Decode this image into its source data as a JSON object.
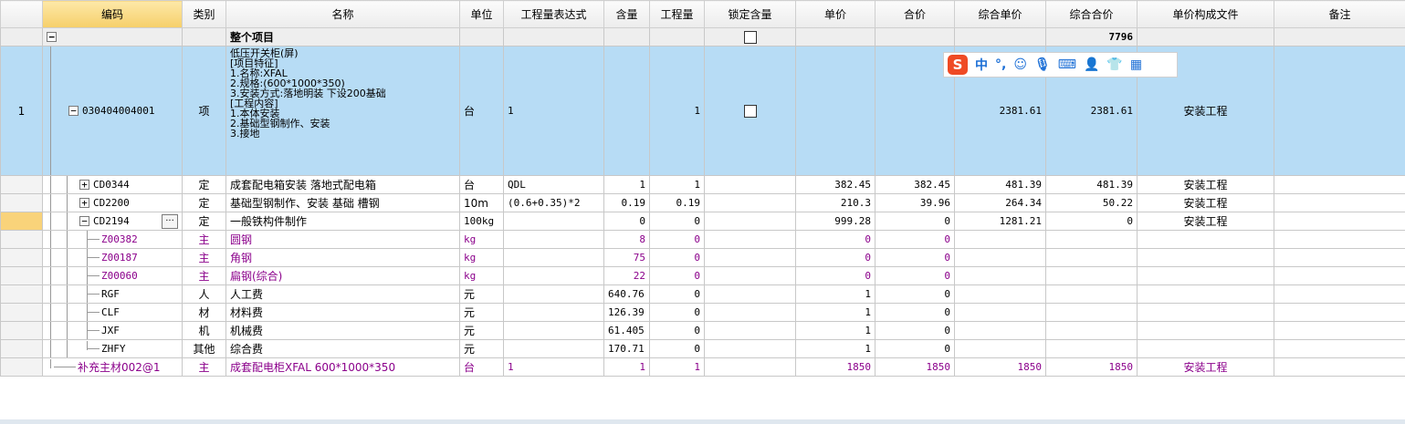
{
  "headers": [
    "",
    "编码",
    "类别",
    "名称",
    "单位",
    "工程量表达式",
    "含量",
    "工程量",
    "锁定含量",
    "单价",
    "合价",
    "综合单价",
    "综合合价",
    "单价构成文件",
    "备注"
  ],
  "total_row": {
    "name": "整个项目",
    "total": "7796"
  },
  "main_item": {
    "rownum": "1",
    "code": "030404004001",
    "type": "项",
    "desc": "低压开关柜(屏)\n[项目特征]\n1.名称:XFAL\n2.规格:(600*1000*350)\n3.安装方式:落地明装 下设200基础\n[工程内容]\n1.本体安装\n2.基础型钢制作、安装\n3.接地",
    "unit": "台",
    "expr": "1",
    "qty": "1",
    "unit_comp": "2381.61",
    "total_comp": "2381.61",
    "file": "安装工程"
  },
  "rows": [
    {
      "code": "CD0344",
      "type": "定",
      "name": "成套配电箱安装 落地式配电箱",
      "unit": "台",
      "expr": "QDL",
      "content": "1",
      "qty": "1",
      "price": "382.45",
      "total": "382.45",
      "unit_comp": "481.39",
      "total_comp": "481.39",
      "file": "安装工程",
      "expander": "+"
    },
    {
      "code": "CD2200",
      "type": "定",
      "name": "基础型钢制作、安装 基础 槽钢",
      "unit": "10m",
      "expr": "(0.6+0.35)*2",
      "content": "0.19",
      "qty": "0.19",
      "price": "210.3",
      "total": "39.96",
      "unit_comp": "264.34",
      "total_comp": "50.22",
      "file": "安装工程",
      "expander": "+"
    },
    {
      "code": "CD2194",
      "type": "定",
      "name": "一般铁构件制作",
      "unit": "100kg",
      "expr": "",
      "content": "0",
      "qty": "0",
      "price": "999.28",
      "total": "0",
      "unit_comp": "1281.21",
      "total_comp": "0",
      "file": "安装工程",
      "expander": "−",
      "ellipsis": "···"
    }
  ],
  "sub_rows": [
    {
      "code": "Z00382",
      "type": "主",
      "name": "圆钢",
      "unit": "kg",
      "content": "8",
      "qty": "0",
      "price": "0",
      "total": "0",
      "purple": true
    },
    {
      "code": "Z00187",
      "type": "主",
      "name": "角钢",
      "unit": "kg",
      "content": "75",
      "qty": "0",
      "price": "0",
      "total": "0",
      "purple": true
    },
    {
      "code": "Z00060",
      "type": "主",
      "name": "扁钢(综合)",
      "unit": "kg",
      "content": "22",
      "qty": "0",
      "price": "0",
      "total": "0",
      "purple": true
    },
    {
      "code": "RGF",
      "type": "人",
      "name": "人工费",
      "unit": "元",
      "content": "640.76",
      "qty": "0",
      "price": "1",
      "total": "0",
      "purple": false
    },
    {
      "code": "CLF",
      "type": "材",
      "name": "材料费",
      "unit": "元",
      "content": "126.39",
      "qty": "0",
      "price": "1",
      "total": "0",
      "purple": false
    },
    {
      "code": "JXF",
      "type": "机",
      "name": "机械费",
      "unit": "元",
      "content": "61.405",
      "qty": "0",
      "price": "1",
      "total": "0",
      "purple": false
    },
    {
      "code": "ZHFY",
      "type": "其他",
      "name": "综合费",
      "unit": "元",
      "content": "170.71",
      "qty": "0",
      "price": "1",
      "total": "0",
      "purple": false
    }
  ],
  "last_row": {
    "code": "补充主材002@1",
    "type": "主",
    "name": "成套配电柜XFAL 600*1000*350",
    "unit": "台",
    "expr": "1",
    "content": "1",
    "qty": "1",
    "price": "1850",
    "total": "1850",
    "unit_comp": "1850",
    "total_comp": "1850",
    "file": "安装工程"
  },
  "collapse_symbol": "−",
  "ime": {
    "logo": "S",
    "items": [
      "中",
      "°,",
      "☺",
      "🎙",
      "⌨",
      "👤",
      "👕",
      "▦"
    ]
  }
}
